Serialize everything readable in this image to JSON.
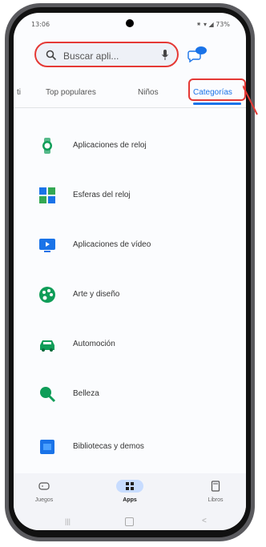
{
  "status": {
    "time": "13:06",
    "right": "⁕ ▾ ◢ 73%"
  },
  "search": {
    "placeholder": "Buscar apli..."
  },
  "tabs": [
    {
      "label": "ti"
    },
    {
      "label": "Top populares"
    },
    {
      "label": "Niños"
    },
    {
      "label": "Categorías"
    }
  ],
  "categories": [
    {
      "label": "Aplicaciones de reloj",
      "icon": "watch-icon",
      "color": "#0f9d58"
    },
    {
      "label": "Esferas del reloj",
      "icon": "watch-face-icon",
      "color": "#1a73e8"
    },
    {
      "label": "Aplicaciones de vídeo",
      "icon": "video-icon",
      "color": "#1a73e8"
    },
    {
      "label": "Arte y diseño",
      "icon": "palette-icon",
      "color": "#0f9d58"
    },
    {
      "label": "Automoción",
      "icon": "car-icon",
      "color": "#0f9d58"
    },
    {
      "label": "Belleza",
      "icon": "beauty-icon",
      "color": "#0f9d58"
    },
    {
      "label": "Bibliotecas y demos",
      "icon": "library-icon",
      "color": "#1a73e8"
    }
  ],
  "bottom_nav": [
    {
      "label": "Juegos",
      "icon": "games-icon"
    },
    {
      "label": "Apps",
      "icon": "apps-icon"
    },
    {
      "label": "Libros",
      "icon": "books-icon"
    }
  ],
  "accent": "#1a73e8",
  "highlight": "#e53935"
}
